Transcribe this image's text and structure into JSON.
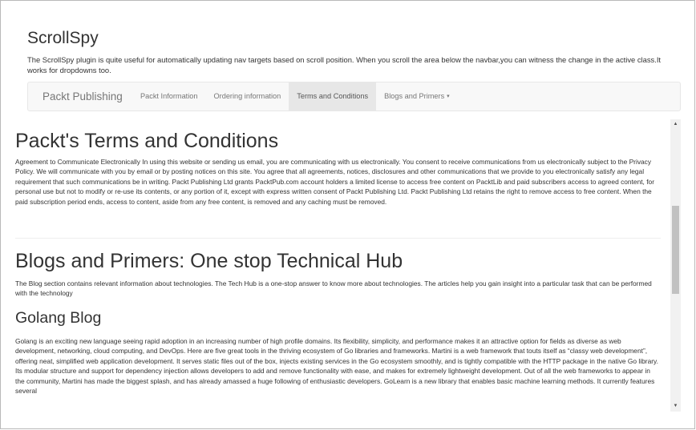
{
  "header": {
    "title": "ScrollSpy",
    "description": "The ScrollSpy plugin is quite useful for automatically updating nav targets based on scroll position. When you scroll the area below the navbar,you can witness the change in the active class.It works for dropdowns too."
  },
  "navbar": {
    "brand": "Packt Publishing",
    "items": [
      {
        "label": "Packt Information",
        "active": false
      },
      {
        "label": "Ordering information",
        "active": false
      },
      {
        "label": "Terms and Conditions",
        "active": true
      },
      {
        "label": "Blogs and Primers",
        "active": false,
        "dropdown": true
      }
    ],
    "caret": "▾"
  },
  "sections": {
    "terms": {
      "heading": "Packt's Terms and Conditions",
      "body": "Agreement to Communicate Electronically In using this website or sending us email, you are communicating with us electronically. You consent to receive communications from us electronically subject to the Privacy Policy. We will communicate with you by email or by posting notices on this site. You agree that all agreements, notices, disclosures and other communications that we provide to you electronically satisfy any legal requirement that such communications be in writing. Packt Publishing Ltd grants PacktPub.com account holders a limited license to access free content on PacktLib and paid subscribers access to agreed content, for personal use but not to modify or re-use its contents, or any portion of it, except with express written consent of Packt Publishing Ltd. Packt Publishing Ltd retains the right to remove access to free content. When the paid subscription period ends, access to content, aside from any free content, is removed and any caching must be removed."
    },
    "blogs": {
      "heading": "Blogs and Primers: One stop Technical Hub",
      "body": "The Blog section contains relevant information about technologies. The Tech Hub is a one-stop answer to know more about technologies. The articles help you gain insight into a particular task that can be performed with the technology"
    },
    "golang": {
      "heading": "Golang Blog",
      "body": "Golang is an exciting new language seeing rapid adoption in an increasing number of high profile domains. Its flexibility, simplicity, and performance makes it an attractive option for fields as diverse as web development, networking, cloud computing, and DevOps. Here are five great tools in the thriving ecosystem of Go libraries and frameworks. Martini is a web framework that touts itself as “classy web development”, offering neat, simplified web application development. It serves static files out of the box, injects existing services in the Go ecosystem smoothly, and is tightly compatible with the HTTP package in the native Go library. Its modular structure and support for dependency injection allows developers to add and remove functionality with ease, and makes for extremely lightweight development. Out of all the web frameworks to appear in the community, Martini has made the biggest splash, and has already amassed a huge following of enthusiastic developers. GoLearn is a new library that enables basic machine learning methods. It currently features several"
    }
  },
  "scrollbar": {
    "up_arrow": "▲",
    "down_arrow": "▼"
  }
}
